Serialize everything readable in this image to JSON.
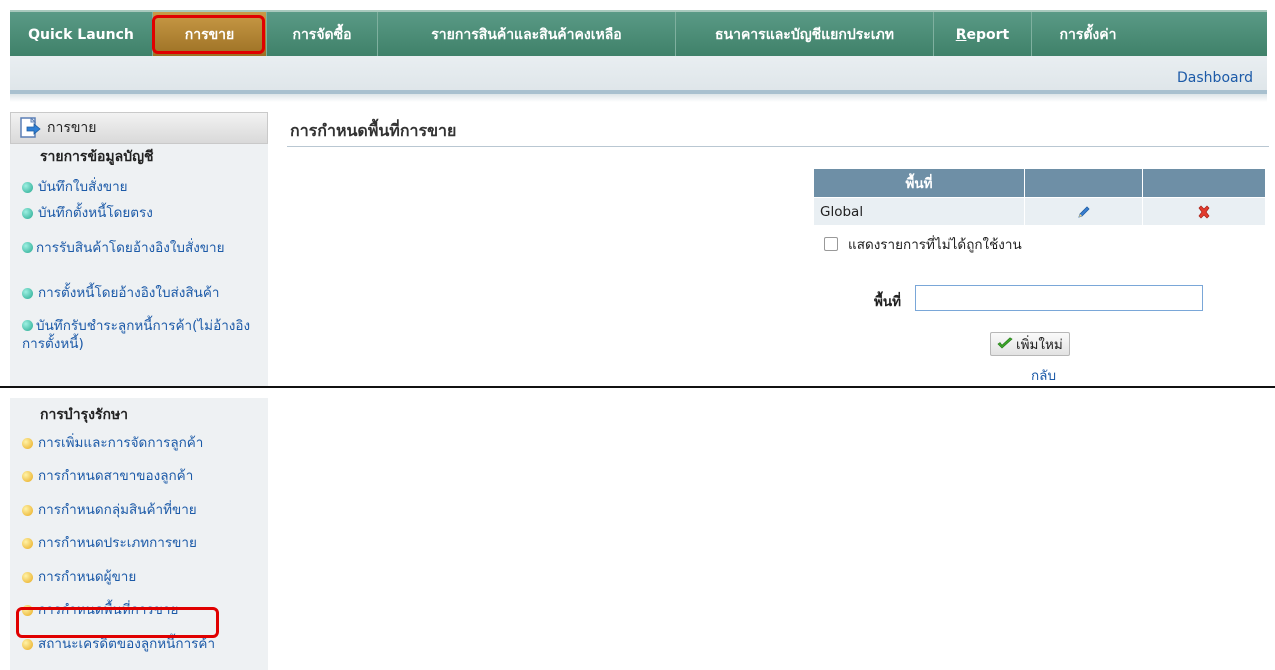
{
  "menu": {
    "items": [
      {
        "label": "Quick Launch",
        "underline": ""
      },
      {
        "label": "การขาย",
        "underline": ""
      },
      {
        "label": "การจัดซื้อ",
        "underline": ""
      },
      {
        "label": "รายการสินค้าและสินค้าคงเหลือ",
        "underline": ""
      },
      {
        "label": "ธนาคารและบัญชีแยกประเภท",
        "underline": ""
      },
      {
        "label": "Report",
        "underline": "R"
      },
      {
        "label": "การตั้งค่า",
        "underline": ""
      }
    ],
    "active_index": 1
  },
  "subbar": {
    "dashboard": "Dashboard"
  },
  "sidebar": {
    "header": "การขาย",
    "section1": {
      "title": "รายการข้อมูลบัญชี",
      "items": [
        "บันทึกใบสั่งขาย",
        "บันทึกตั้งหนี้โดยตรง",
        "การรับสินค้าโดยอ้างอิงใบสั่งขาย",
        "การตั้งหนี้โดยอ้างอิงใบส่งสินค้า",
        "บันทึกรับชำระลูกหนี้การค้า(ไม่อ้างอิงการตั้งหนี้)"
      ]
    },
    "section2": {
      "title": "การบำรุงรักษา",
      "items": [
        "การเพิ่มและการจัดการลูกค้า",
        "การกำหนดสาขาของลูกค้า",
        "การกำหนดกลุ่มสินค้าที่ขาย",
        "การกำหนดประเภทการขาย",
        "การกำหนดผู้ขาย",
        "การกำหนดพื้นที่การขาย",
        "สถานะเครดิตของลูกหนี้การค้า"
      ]
    }
  },
  "main": {
    "title": "การกำหนดพื้นที่การขาย",
    "table": {
      "header": "พื้นที่",
      "rows": [
        {
          "area": "Global"
        }
      ]
    },
    "show_inactive_label": "แสดงรายการที่ไม่ได้ถูกใช้งาน",
    "area_field_label": "พื้นที่",
    "area_field_value": "",
    "add_button": "เพิ่มใหม่",
    "back_link": "กลับ"
  },
  "colors": {
    "menu_bg": "#4a8c76",
    "menu_active": "#b5852f",
    "highlight": "#e00000",
    "link": "#1c5aa8",
    "table_header": "#6e8fa6"
  }
}
